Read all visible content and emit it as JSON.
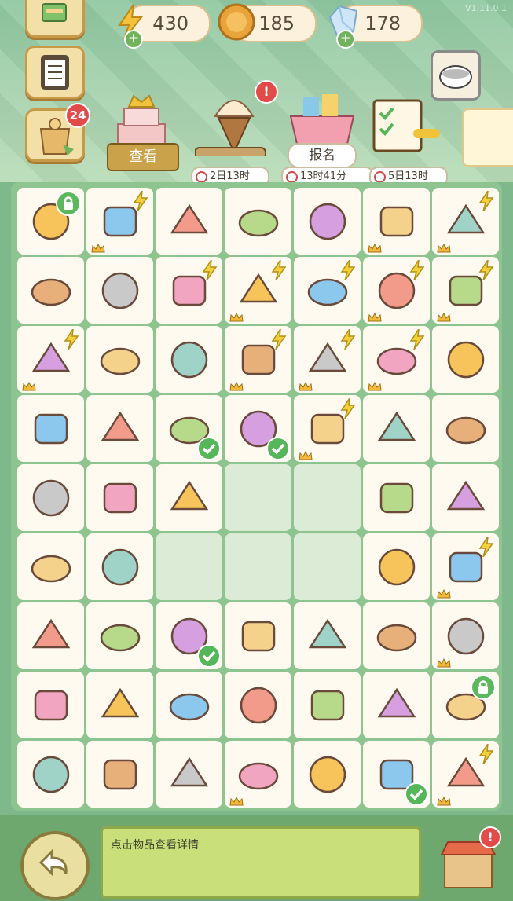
{
  "header": {
    "version_text": "V1.11.0.1",
    "resources": [
      {
        "name": "energy",
        "value": "430",
        "icon": "lightning-icon"
      },
      {
        "name": "coins",
        "value": "185",
        "icon": "coin-icon"
      },
      {
        "name": "gems",
        "value": "178",
        "icon": "diamond-icon"
      }
    ],
    "side_badge": "24"
  },
  "events": [
    {
      "name": "cake-event",
      "label": "查看"
    },
    {
      "name": "icecream-event",
      "timer": "2日13时"
    },
    {
      "name": "basket-event",
      "label": "报名",
      "timer": "13时41分"
    },
    {
      "name": "checklist-event",
      "timer": "5日13时"
    }
  ],
  "grid_items": [
    "leaf-wrap",
    "gold-ticket",
    "gold-card",
    "hotpot",
    "soup-pot",
    "chopsticks",
    "gold-ticket",
    "blue-orb",
    "paper-ball",
    "treasure-chest",
    "bottles-set",
    "towel-roll",
    "basket",
    "green-bag",
    "potion",
    "soap",
    "blue-card",
    "fish-box",
    "flower-pot",
    "gift-box",
    "shorts-pink",
    "shorts-yellow",
    "blue-soap",
    "paper-stack",
    "towel-rolls",
    "towel-rolls",
    "lavender",
    "color-sheets",
    "tube",
    "bikini",
    "swim-ring",
    "",
    "",
    "hose",
    "blue-card",
    "keychain",
    "lotion",
    "",
    "",
    "",
    "bear-gummy",
    "towel-roll",
    "shaker",
    "mint-leaf",
    "otter-ring",
    "lemon",
    "cocktail",
    "squeegee",
    "tiki-mug",
    "scissors",
    "iced-drink",
    "cream-tube",
    "goggles",
    "fish-bucket",
    "coin-200",
    "pufferfish",
    "watch",
    "sea-otter",
    "spray",
    "sunscreen",
    "pond",
    "beach-ball",
    "picnic-basket"
  ],
  "info": {
    "text": "点击物品查看详情"
  },
  "colors": {
    "board": "#8ec48f",
    "cell": "#fffaf0",
    "accent": "#56b65a"
  }
}
